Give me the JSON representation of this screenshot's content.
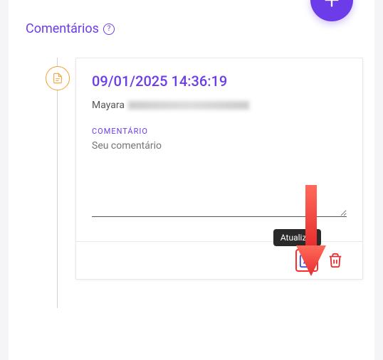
{
  "header": {
    "title": "Comentários"
  },
  "comment": {
    "timestamp": "09/01/2025 14:36:19",
    "author_name": "Mayara",
    "field_label": "COMENTÁRIO",
    "placeholder": "Seu comentário",
    "value": ""
  },
  "actions": {
    "edit_tooltip": "Atualizar"
  }
}
